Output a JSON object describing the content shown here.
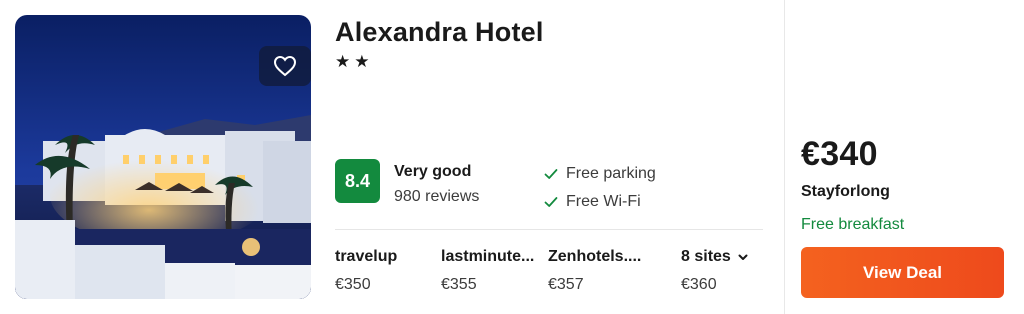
{
  "hotel": {
    "name": "Alexandra Hotel",
    "stars": "★★",
    "star_count": 2
  },
  "photo": {
    "favorite_icon": "heart-outline-icon"
  },
  "rating": {
    "score": "8.4",
    "label": "Very good",
    "reviews": "980 reviews",
    "badge_color": "#138a3e"
  },
  "amenities": [
    {
      "label": "Free parking",
      "icon": "check-icon"
    },
    {
      "label": "Free Wi-Fi",
      "icon": "check-icon"
    }
  ],
  "sites": [
    {
      "name": "travelup",
      "price": "€350"
    },
    {
      "name": "lastminute...",
      "price": "€355"
    },
    {
      "name": "Zenhotels....",
      "price": "€357"
    },
    {
      "name": "8 sites",
      "price": "€360",
      "icon": "chevron-down-icon"
    }
  ],
  "deal": {
    "price": "€340",
    "provider": "Stayforlong",
    "perk": "Free breakfast",
    "cta_label": "View Deal",
    "accent": "#f4621f",
    "perk_color": "#138a3e"
  }
}
